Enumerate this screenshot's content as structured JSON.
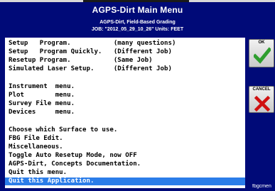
{
  "window": {
    "title": "AGPS-Dirt  Main Menu",
    "subtitle": "AGPS-Dirt, Field-Based Grading",
    "job_line": "JOB: \"2012_05_29_10_26\"  Units: FEET"
  },
  "menu": {
    "items": [
      {
        "label": "Setup   Program.           (many questions)"
      },
      {
        "label": "Setup   Program Quickly.   (Different Job)"
      },
      {
        "label": "Resetup Program.           (Same Job)"
      },
      {
        "label": "Simulated Laser Setup.     (Different Job)"
      },
      {
        "label": ""
      },
      {
        "label": "Instrument  menu."
      },
      {
        "label": "Plot        menu."
      },
      {
        "label": "Survey File menu."
      },
      {
        "label": "Devices     menu."
      },
      {
        "label": ""
      },
      {
        "label": "Choose which Surface to use."
      },
      {
        "label": "FBG File Edit."
      },
      {
        "label": "Miscellaneous."
      },
      {
        "label": "Toggle Auto Resetup Mode, now OFF"
      },
      {
        "label": "AGPS-Dirt, Concepts Documentation."
      },
      {
        "label": "Quit this menu."
      },
      {
        "label": "Quit this Application."
      }
    ],
    "selected_index": 16
  },
  "buttons": {
    "ok_label": "OK",
    "cancel_label": "CANCEL"
  },
  "status": {
    "text": "fbgcmen"
  },
  "colors": {
    "background": "#000a78",
    "selection": "#2b7de9",
    "ok_check": "#2e9e2e",
    "cancel_x": "#d01010"
  }
}
